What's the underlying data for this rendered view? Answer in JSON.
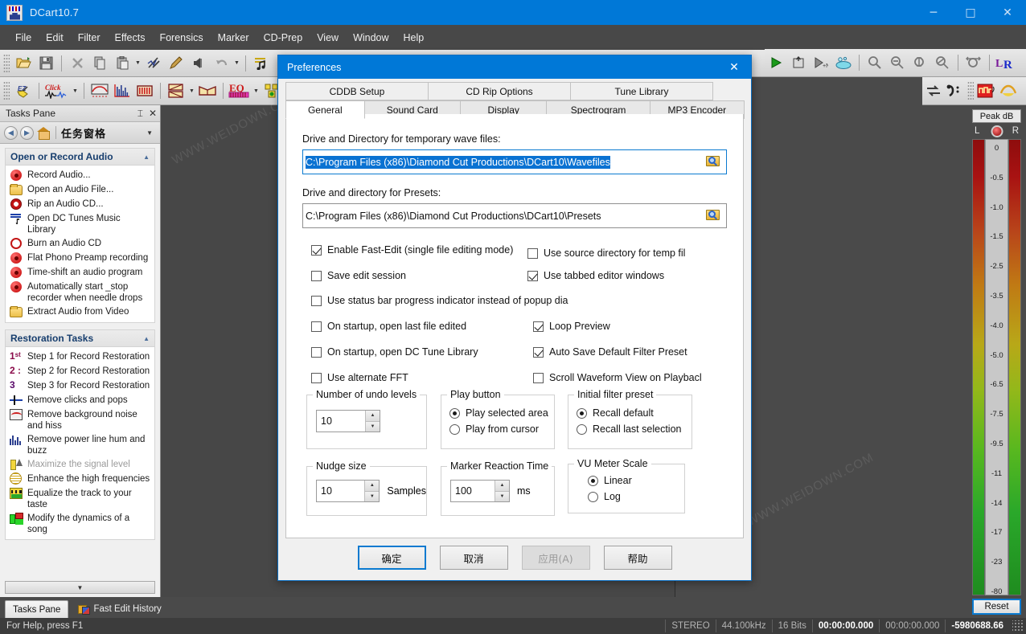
{
  "window": {
    "title": "DCart10.7",
    "app_icon": "dcart-icon",
    "minimize": "─",
    "maximize": "□",
    "close": "✕",
    "accent_color": "#0078d7"
  },
  "menubar": {
    "items": [
      "File",
      "Edit",
      "Filter",
      "Effects",
      "Forensics",
      "Marker",
      "CD-Prep",
      "View",
      "Window",
      "Help"
    ]
  },
  "toolbar_row1": {
    "icons": [
      "open-folder-icon",
      "save-icon",
      "cut-x-icon",
      "copy-icon",
      "paste-icon",
      "trim-icon",
      "pencil-icon",
      "mute-icon",
      "undo-icon",
      "music-note-icon"
    ]
  },
  "toolbar_row1_right": {
    "icons": [
      "play-icon",
      "export-icon",
      "play-to-n-icon",
      "cleanup-icon",
      "zoom-out-icon",
      "zoom-minus-icon",
      "zoom-fit-v-icon",
      "zoom-sel-icon",
      "zoom-full-icon",
      "lr-channels-icon"
    ]
  },
  "toolbar_row2": {
    "icons": [
      "ez-icon",
      "click-icon",
      "spectrum-icon",
      "histogram-icon",
      "level-icon",
      "envelope-icon",
      "stereo-icon",
      "eq-icon",
      "dynamics-icon"
    ]
  },
  "toolbar_row2_right": {
    "icons": [
      "swap-icon",
      "bass-clef-icon",
      "virtual-valve-icon",
      "fade-icon"
    ]
  },
  "tasks_pane": {
    "title": "Tasks Pane",
    "pin_icon": "pin-icon",
    "close_icon": "close-icon",
    "nav": {
      "back_icon": "back-arrow-icon",
      "forward_icon": "forward-arrow-icon",
      "home_icon": "home-icon",
      "label": "任务窗格",
      "chevron_icon": "chevron-down-icon"
    },
    "groups": [
      {
        "title": "Open or Record Audio",
        "collapse_icon": "chevron-up-icon",
        "items": [
          {
            "label": "Record Audio...",
            "icon": "record-icon",
            "enabled": true
          },
          {
            "label": "Open an Audio File...",
            "icon": "open-folder-icon",
            "enabled": true
          },
          {
            "label": "Rip an Audio CD...",
            "icon": "cd-rip-icon",
            "enabled": true
          },
          {
            "label": "Open DC Tunes Music Library",
            "icon": "music-library-icon",
            "enabled": true
          },
          {
            "label": "Burn an Audio CD",
            "icon": "burn-cd-icon",
            "enabled": true
          },
          {
            "label": "Flat Phono Preamp recording",
            "icon": "record-icon",
            "enabled": true
          },
          {
            "label": "Time-shift an audio program",
            "icon": "record-icon",
            "enabled": true
          },
          {
            "label": "Automatically start _stop recorder when needle drops",
            "icon": "record-icon",
            "enabled": true
          },
          {
            "label": "Extract Audio from Video",
            "icon": "open-folder-icon",
            "enabled": true
          }
        ]
      },
      {
        "title": "Restoration Tasks",
        "collapse_icon": "chevron-up-icon",
        "items": [
          {
            "label": "Step 1 for Record Restoration",
            "icon": "step-1-icon",
            "enabled": true
          },
          {
            "label": "Step 2 for Record Restoration",
            "icon": "step-2-icon",
            "enabled": true
          },
          {
            "label": "Step 3 for Record Restoration",
            "icon": "step-3-icon",
            "enabled": true
          },
          {
            "label": "Remove clicks and pops",
            "icon": "click-pop-icon",
            "enabled": true
          },
          {
            "label": "Remove background noise and hiss",
            "icon": "noise-icon",
            "enabled": true
          },
          {
            "label": "Remove power line hum and buzz",
            "icon": "hum-icon",
            "enabled": true
          },
          {
            "label": "Maximize the signal level",
            "icon": "maximize-level-icon",
            "enabled": false
          },
          {
            "label": "Enhance the high frequencies",
            "icon": "high-freq-icon",
            "enabled": true
          },
          {
            "label": "Equalize the track to your taste",
            "icon": "equalizer-icon",
            "enabled": true
          },
          {
            "label": "Modify the dynamics of a song",
            "icon": "dynamics-icon",
            "enabled": true
          }
        ]
      }
    ],
    "scroll_down_icon": "chevron-down-icon",
    "tabs": [
      {
        "label": "Tasks Pane",
        "active": true,
        "icon": ""
      },
      {
        "label": "Fast Edit History",
        "active": false,
        "icon": "fast-edit-history-icon"
      }
    ]
  },
  "dialog": {
    "title": "Preferences",
    "close_icon": "close-icon",
    "tabs_row1": [
      "CDDB Setup",
      "CD Rip Options",
      "Tune Library"
    ],
    "tabs_row2": [
      "General",
      "Sound Card",
      "Display",
      "Spectrogram",
      "MP3 Encoder"
    ],
    "active_tab": "General",
    "temp_label": "Drive and Directory for temporary wave files:",
    "temp_value": "C:\\Program Files (x86)\\Diamond Cut Productions\\DCart10\\Wavefiles",
    "presets_label": "Drive and directory for Presets:",
    "presets_value": "C:\\Program Files (x86)\\Diamond Cut Productions\\DCart10\\Presets",
    "browse_icon": "browse-folder-icon",
    "checkboxes": [
      {
        "label": "Enable Fast-Edit (single file editing mode)",
        "checked": true
      },
      {
        "label": "Use source directory for temp fil",
        "checked": false
      },
      {
        "label": "Save edit session",
        "checked": false
      },
      {
        "label": "Use tabbed editor windows",
        "checked": true
      },
      {
        "label": "Use status bar progress indicator instead of popup dia",
        "checked": false
      },
      {
        "label": "On startup, open last file edited",
        "checked": false
      },
      {
        "label": "Loop Preview",
        "checked": true
      },
      {
        "label": "On startup, open DC Tune Library",
        "checked": false
      },
      {
        "label": "Auto Save Default Filter Preset",
        "checked": true
      },
      {
        "label": "Use alternate FFT",
        "checked": false
      },
      {
        "label": "Scroll Waveform View on Playbacl",
        "checked": false
      }
    ],
    "groups": {
      "undo": {
        "title": "Number of undo levels",
        "value": "10"
      },
      "play_button": {
        "title": "Play button",
        "options": [
          {
            "label": "Play selected area",
            "selected": true
          },
          {
            "label": "Play from cursor",
            "selected": false
          }
        ]
      },
      "initial_filter": {
        "title": "Initial filter preset",
        "options": [
          {
            "label": "Recall default",
            "selected": true
          },
          {
            "label": "Recall last selection",
            "selected": false
          }
        ]
      },
      "nudge": {
        "title": "Nudge size",
        "value": "10",
        "unit": "Samples"
      },
      "marker": {
        "title": "Marker Reaction Time",
        "value": "100",
        "unit": "ms"
      },
      "vu_scale": {
        "title": "VU Meter Scale",
        "options": [
          {
            "label": "Linear",
            "selected": true
          },
          {
            "label": "Log",
            "selected": false
          }
        ]
      }
    },
    "buttons": [
      {
        "label": "确定",
        "default": true,
        "disabled": false
      },
      {
        "label": "取消",
        "default": false,
        "disabled": false
      },
      {
        "label": "应用(A)",
        "default": false,
        "disabled": true
      },
      {
        "label": "帮助",
        "default": false,
        "disabled": false
      }
    ]
  },
  "vu_meter": {
    "peak_label": "Peak dB",
    "left_label": "L",
    "right_label": "R",
    "led_icon": "peak-led-icon",
    "scale_ticks": [
      "0",
      "-0.5",
      "-1.0",
      "-1.5",
      "-2.5",
      "-3.5",
      "-4.0",
      "-5.0",
      "-6.5",
      "-7.5",
      "-9.5",
      "-11",
      "-14",
      "-17",
      "-23",
      "-80"
    ],
    "reset_label": "Reset"
  },
  "statusbar": {
    "help_text": "For Help, press F1",
    "cells": [
      {
        "text": "STEREO",
        "strong": false
      },
      {
        "text": "44.100kHz",
        "strong": false
      },
      {
        "text": "16 Bits",
        "strong": false
      },
      {
        "text": "00:00:00.000",
        "strong": true
      },
      {
        "text": "00:00:00.000",
        "strong": false
      },
      {
        "text": "-5980688.66",
        "strong": true
      }
    ]
  },
  "watermarks": [
    "WWW.WEIDOWN.COM",
    "WWW.WEIDOWN.COM",
    "WWW.WEIDOWN.COM"
  ]
}
